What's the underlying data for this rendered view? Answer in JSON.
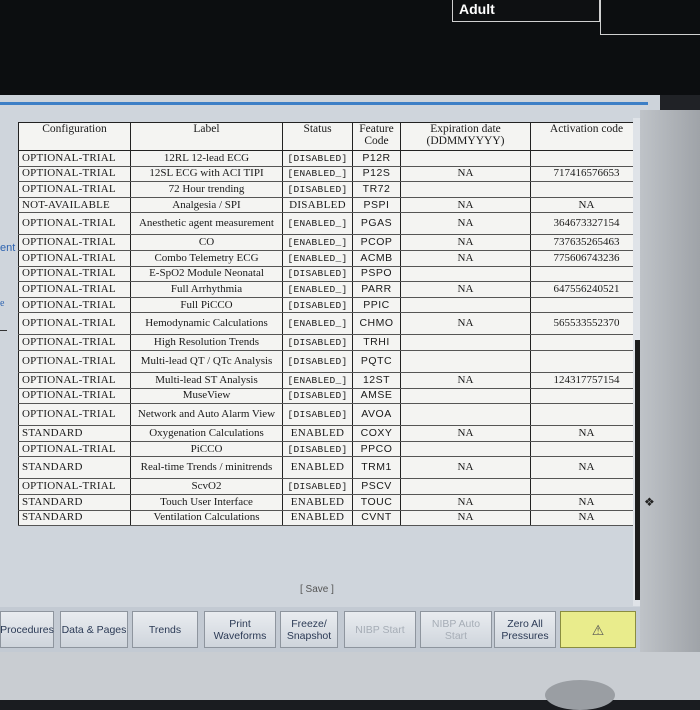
{
  "header": {
    "patient_category": "Adult"
  },
  "left_edge": {
    "fragment": "ent",
    "fragment2": "e"
  },
  "table": {
    "columns": [
      "Configuration",
      "Label",
      "Status",
      "Feature Code",
      "Expiration date (DDMMYYYY)",
      "Activation code"
    ],
    "rows": [
      {
        "configuration": "OPTIONAL-TRIAL",
        "label": "12RL 12-lead ECG",
        "status": "[DISABLED]",
        "code": "P12R",
        "expiration": "",
        "activation": ""
      },
      {
        "configuration": "OPTIONAL-TRIAL",
        "label": "12SL ECG with ACI TIPI",
        "status": "[ENABLED_]",
        "code": "P12S",
        "expiration": "NA",
        "activation": "717416576653"
      },
      {
        "configuration": "OPTIONAL-TRIAL",
        "label": "72 Hour trending",
        "status": "[DISABLED]",
        "code": "TR72",
        "expiration": "",
        "activation": ""
      },
      {
        "configuration": "NOT-AVAILABLE",
        "label": "Analgesia / SPI",
        "status": "DISABLED",
        "code": "PSPI",
        "expiration": "NA",
        "activation": "NA"
      },
      {
        "configuration": "OPTIONAL-TRIAL",
        "label": "Anesthetic agent measurement",
        "status": "[ENABLED_]",
        "code": "PGAS",
        "expiration": "NA",
        "activation": "364673327154"
      },
      {
        "configuration": "OPTIONAL-TRIAL",
        "label": "CO",
        "status": "[ENABLED_]",
        "code": "PCOP",
        "expiration": "NA",
        "activation": "737635265463"
      },
      {
        "configuration": "OPTIONAL-TRIAL",
        "label": "Combo Telemetry ECG",
        "status": "[ENABLED_]",
        "code": "ACMB",
        "expiration": "NA",
        "activation": "775606743236"
      },
      {
        "configuration": "OPTIONAL-TRIAL",
        "label": "E-SpO2 Module Neonatal",
        "status": "[DISABLED]",
        "code": "PSPO",
        "expiration": "",
        "activation": ""
      },
      {
        "configuration": "OPTIONAL-TRIAL",
        "label": "Full Arrhythmia",
        "status": "[ENABLED_]",
        "code": "PARR",
        "expiration": "NA",
        "activation": "647556240521"
      },
      {
        "configuration": "OPTIONAL-TRIAL",
        "label": "Full PiCCO",
        "status": "[DISABLED]",
        "code": "PPIC",
        "expiration": "",
        "activation": ""
      },
      {
        "configuration": "OPTIONAL-TRIAL",
        "label": "Hemodynamic Calculations",
        "status": "[ENABLED_]",
        "code": "CHMO",
        "expiration": "NA",
        "activation": "565533552370"
      },
      {
        "configuration": "OPTIONAL-TRIAL",
        "label": "High Resolution Trends",
        "status": "[DISABLED]",
        "code": "TRHI",
        "expiration": "",
        "activation": ""
      },
      {
        "configuration": "OPTIONAL-TRIAL",
        "label": "Multi-lead QT / QTc Analysis",
        "status": "[DISABLED]",
        "code": "PQTC",
        "expiration": "",
        "activation": ""
      },
      {
        "configuration": "OPTIONAL-TRIAL",
        "label": "Multi-lead ST Analysis",
        "status": "[ENABLED_]",
        "code": "12ST",
        "expiration": "NA",
        "activation": "124317757154"
      },
      {
        "configuration": "OPTIONAL-TRIAL",
        "label": "MuseView",
        "status": "[DISABLED]",
        "code": "AMSE",
        "expiration": "",
        "activation": ""
      },
      {
        "configuration": "OPTIONAL-TRIAL",
        "label": "Network and Auto Alarm View",
        "status": "[DISABLED]",
        "code": "AVOA",
        "expiration": "",
        "activation": ""
      },
      {
        "configuration": "STANDARD",
        "label": "Oxygenation Calculations",
        "status": "ENABLED",
        "code": "COXY",
        "expiration": "NA",
        "activation": "NA"
      },
      {
        "configuration": "OPTIONAL-TRIAL",
        "label": "PiCCO",
        "status": "[DISABLED]",
        "code": "PPCO",
        "expiration": "",
        "activation": ""
      },
      {
        "configuration": "STANDARD",
        "label": "Real-time Trends / minitrends",
        "status": "ENABLED",
        "code": "TRM1",
        "expiration": "NA",
        "activation": "NA"
      },
      {
        "configuration": "OPTIONAL-TRIAL",
        "label": "ScvO2",
        "status": "[DISABLED]",
        "code": "PSCV",
        "expiration": "",
        "activation": ""
      },
      {
        "configuration": "STANDARD",
        "label": "Touch User Interface",
        "status": "ENABLED",
        "code": "TOUC",
        "expiration": "NA",
        "activation": "NA"
      },
      {
        "configuration": "STANDARD",
        "label": "Ventilation Calculations",
        "status": "ENABLED",
        "code": "CVNT",
        "expiration": "NA",
        "activation": "NA"
      }
    ]
  },
  "save_label": "[ Save ]",
  "softkeys": {
    "procedures": "Procedures",
    "data_pages": "Data & Pages",
    "trends": "Trends",
    "print_waveforms": "Print Waveforms",
    "freeze_snapshot": "Freeze/ Snapshot",
    "nibp_start": "NIBP Start",
    "nibp_auto": "NIBP Auto Start",
    "zero_all": "Zero All Pressures",
    "alarm_icon": "bell-alarm-icon"
  }
}
